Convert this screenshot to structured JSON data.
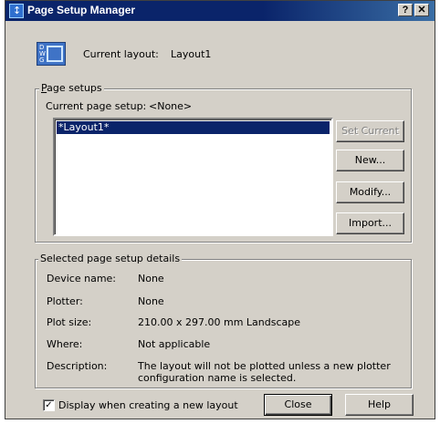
{
  "window": {
    "title": "Page Setup Manager",
    "help_button": "?",
    "close_button": "✕"
  },
  "header": {
    "icon_letters": "D W G",
    "current_layout_label": "Current layout:",
    "current_layout_value": "Layout1"
  },
  "page_setups": {
    "legend": "Page setups",
    "current_label": "Current page setup:",
    "current_value": "<None>",
    "list_items": [
      "*Layout1*"
    ],
    "buttons": {
      "set_current": "Set Current",
      "new": "New...",
      "modify": "Modify...",
      "import": "Import..."
    }
  },
  "details": {
    "legend": "Selected page setup details",
    "device_name_label": "Device name:",
    "device_name_value": "None",
    "plotter_label": "Plotter:",
    "plotter_value": "None",
    "plot_size_label": "Plot size:",
    "plot_size_value": "210.00 x 297.00 mm Landscape",
    "where_label": "Where:",
    "where_value": "Not applicable",
    "description_label": "Description:",
    "description_line1": "The layout will not be plotted unless a new plotter",
    "description_line2": "configuration name is selected."
  },
  "footer": {
    "checkbox_label": "Display when creating a new layout",
    "checkbox_checked": "✓",
    "close_label": "Close",
    "help_label": "Help"
  }
}
